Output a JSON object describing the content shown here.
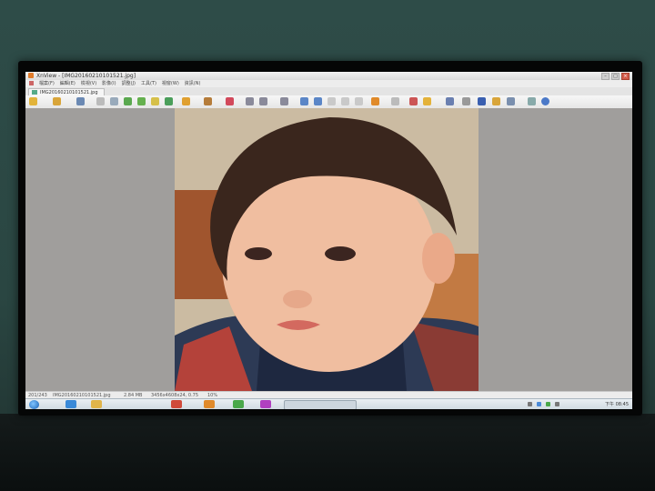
{
  "window": {
    "title": "XnView - [IMG20160210101521.jpg]"
  },
  "menu": {
    "items": [
      "檔案(F)",
      "編輯(E)",
      "檢視(V)",
      "影像(I)",
      "調整(J)",
      "工具(T)",
      "視窗(W)",
      "資訊(N)"
    ]
  },
  "tab": {
    "label": "IMG20160210101521.jpg"
  },
  "status": {
    "index": "201/243",
    "filename": "IMG20160210101521.jpg",
    "filesize": "2.84 MB",
    "dimensions": "3456x4608x24, 0.75",
    "zoom": "10%"
  },
  "taskbar": {
    "clock": "下午 08:45"
  },
  "colors": {
    "viewer_bg": "#a09e9c",
    "title_bg": "#e8e8e8",
    "accent": "#1a62b5"
  }
}
